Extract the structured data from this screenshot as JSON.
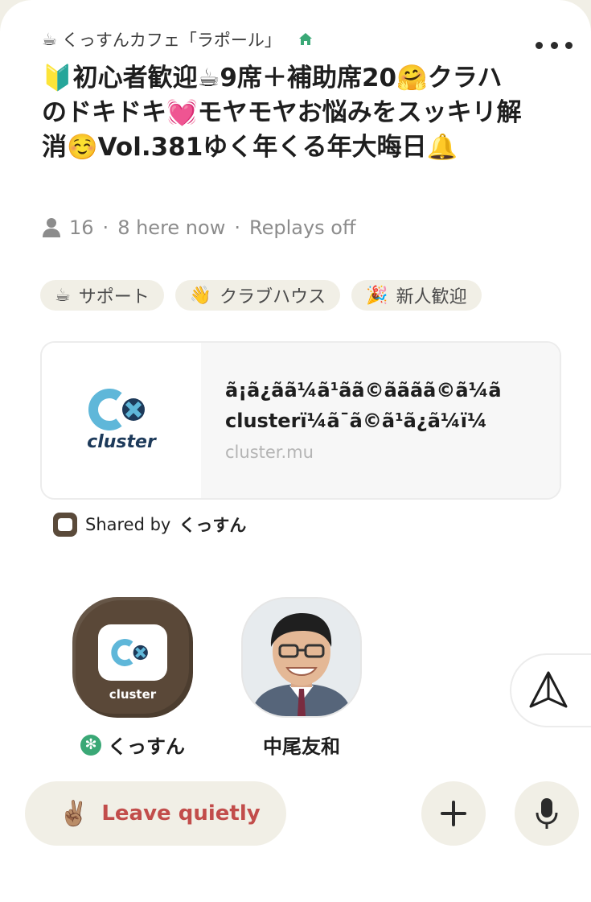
{
  "club": {
    "emoji": "☕",
    "name": "くっすんカフェ「ラポール」"
  },
  "room": {
    "title": "🔰初心者歓迎☕9席＋補助席20🤗クラハのドキドキ💓モヤモヤお悩みをスッキリ解消☺️Vol.381ゆく年くる年大晦日🔔"
  },
  "stats": {
    "listener_count": "16",
    "here_now": "8 here now",
    "replays": "Replays off",
    "separator": "·"
  },
  "tags": [
    {
      "emoji": "☕",
      "label": "サポート"
    },
    {
      "emoji": "👋",
      "label": "クラブハウス"
    },
    {
      "emoji": "🎉",
      "label": "新人歓迎"
    }
  ],
  "link_card": {
    "title_line1": "ã¡ã¿ãã¼ã¹ãã©ãããã©ã¼ã",
    "title_line2": "clusterï¼ã¯ã©ã¹ã¿ã¼ï¼",
    "domain": "cluster.mu",
    "logo_text": "cluster"
  },
  "shared_by": {
    "prefix": "Shared by",
    "name": "くっすん"
  },
  "speakers": [
    {
      "name": "くっすん",
      "tile_label": "cluster",
      "badge": "✻"
    },
    {
      "name": "中尾友和"
    }
  ],
  "actions": {
    "leave_emoji": "✌🏽",
    "leave_label": "Leave quietly"
  },
  "colors": {
    "accent_red": "#c24d4b",
    "house_green": "#3aa876",
    "pill_bg": "#f1efe6"
  }
}
